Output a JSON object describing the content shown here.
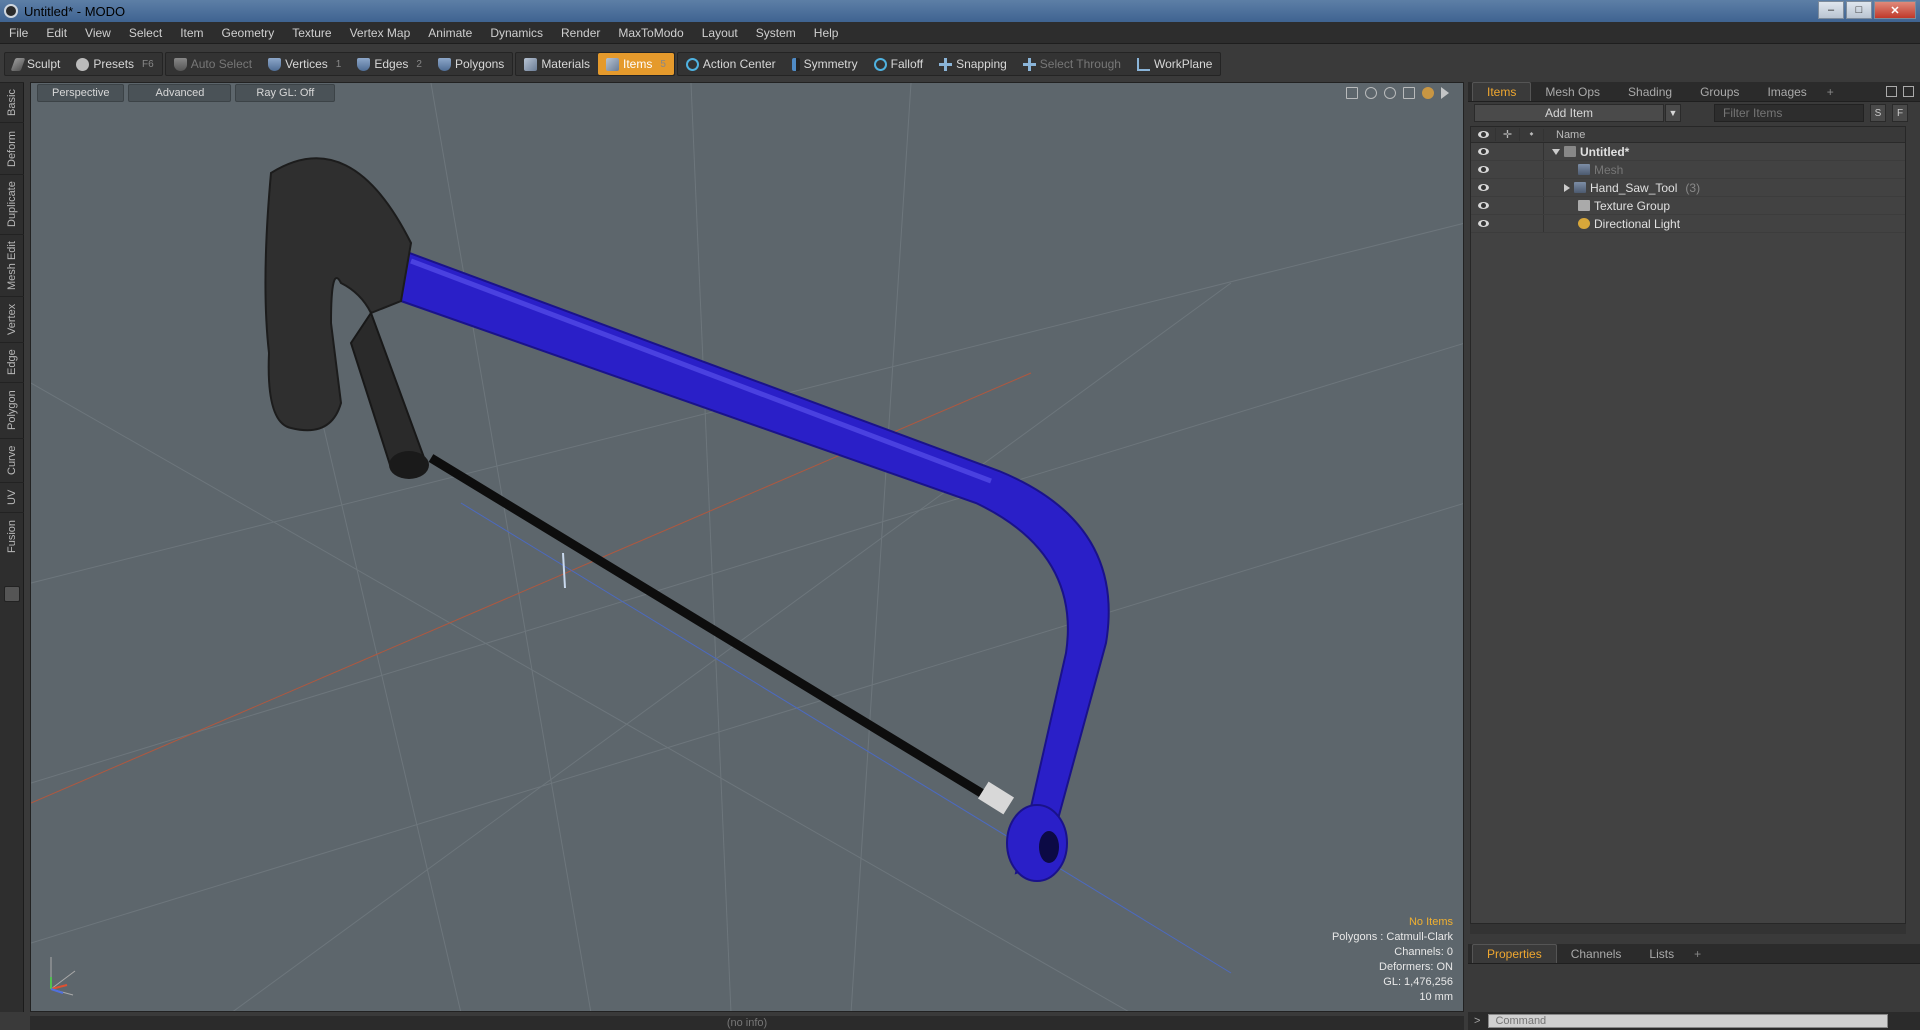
{
  "window": {
    "title": "Untitled* - MODO",
    "minimize": "–",
    "maximize": "□",
    "close": "✕"
  },
  "menu": [
    "File",
    "Edit",
    "View",
    "Select",
    "Item",
    "Geometry",
    "Texture",
    "Vertex Map",
    "Animate",
    "Dynamics",
    "Render",
    "MaxToModo",
    "Layout",
    "System",
    "Help"
  ],
  "toolbar": {
    "sculpt": "Sculpt",
    "presets": "Presets",
    "presets_key": "F6",
    "auto_select": "Auto Select",
    "vertices": "Vertices",
    "vertices_key": "1",
    "edges": "Edges",
    "edges_key": "2",
    "polygons": "Polygons",
    "materials": "Materials",
    "items": "Items",
    "items_key": "5",
    "action_center": "Action Center",
    "symmetry": "Symmetry",
    "falloff": "Falloff",
    "snapping": "Snapping",
    "select_through": "Select Through",
    "workplane": "WorkPlane"
  },
  "left_tabs": [
    "Basic",
    "Deform",
    "Duplicate",
    "Mesh Edit",
    "Vertex",
    "Edge",
    "Polygon",
    "Curve",
    "UV",
    "Fusion"
  ],
  "viewport": {
    "view": "Perspective",
    "shading": "Advanced",
    "raygl": "Ray GL: Off",
    "info": {
      "items": "No Items",
      "polygons": "Polygons : Catmull-Clark",
      "channels": "Channels: 0",
      "deformers": "Deformers: ON",
      "gl": "GL: 1,476,256",
      "scale": "10 mm"
    }
  },
  "items_panel": {
    "tabs": [
      "Items",
      "Mesh Ops",
      "Shading",
      "Groups",
      "Images"
    ],
    "add_item": "Add Item",
    "filter_placeholder": "Filter Items",
    "s_btn": "S",
    "f_btn": "F",
    "name_col": "Name",
    "tree": [
      {
        "label": "Untitled*",
        "kind": "scene"
      },
      {
        "label": "Mesh",
        "kind": "mesh"
      },
      {
        "label": "Hand_Saw_Tool",
        "count": "(3)",
        "kind": "mesh"
      },
      {
        "label": "Texture Group",
        "kind": "texture"
      },
      {
        "label": "Directional Light",
        "kind": "light"
      }
    ]
  },
  "props_panel": {
    "tabs": [
      "Properties",
      "Channels",
      "Lists"
    ]
  },
  "command": {
    "prompt": ">",
    "placeholder": "Command"
  },
  "status": "(no info)",
  "colors": {
    "accent": "#e59a2c",
    "saw_frame": "#2a1fc8",
    "handle": "#2c2c2c",
    "viewport_bg": "#5d666c"
  }
}
